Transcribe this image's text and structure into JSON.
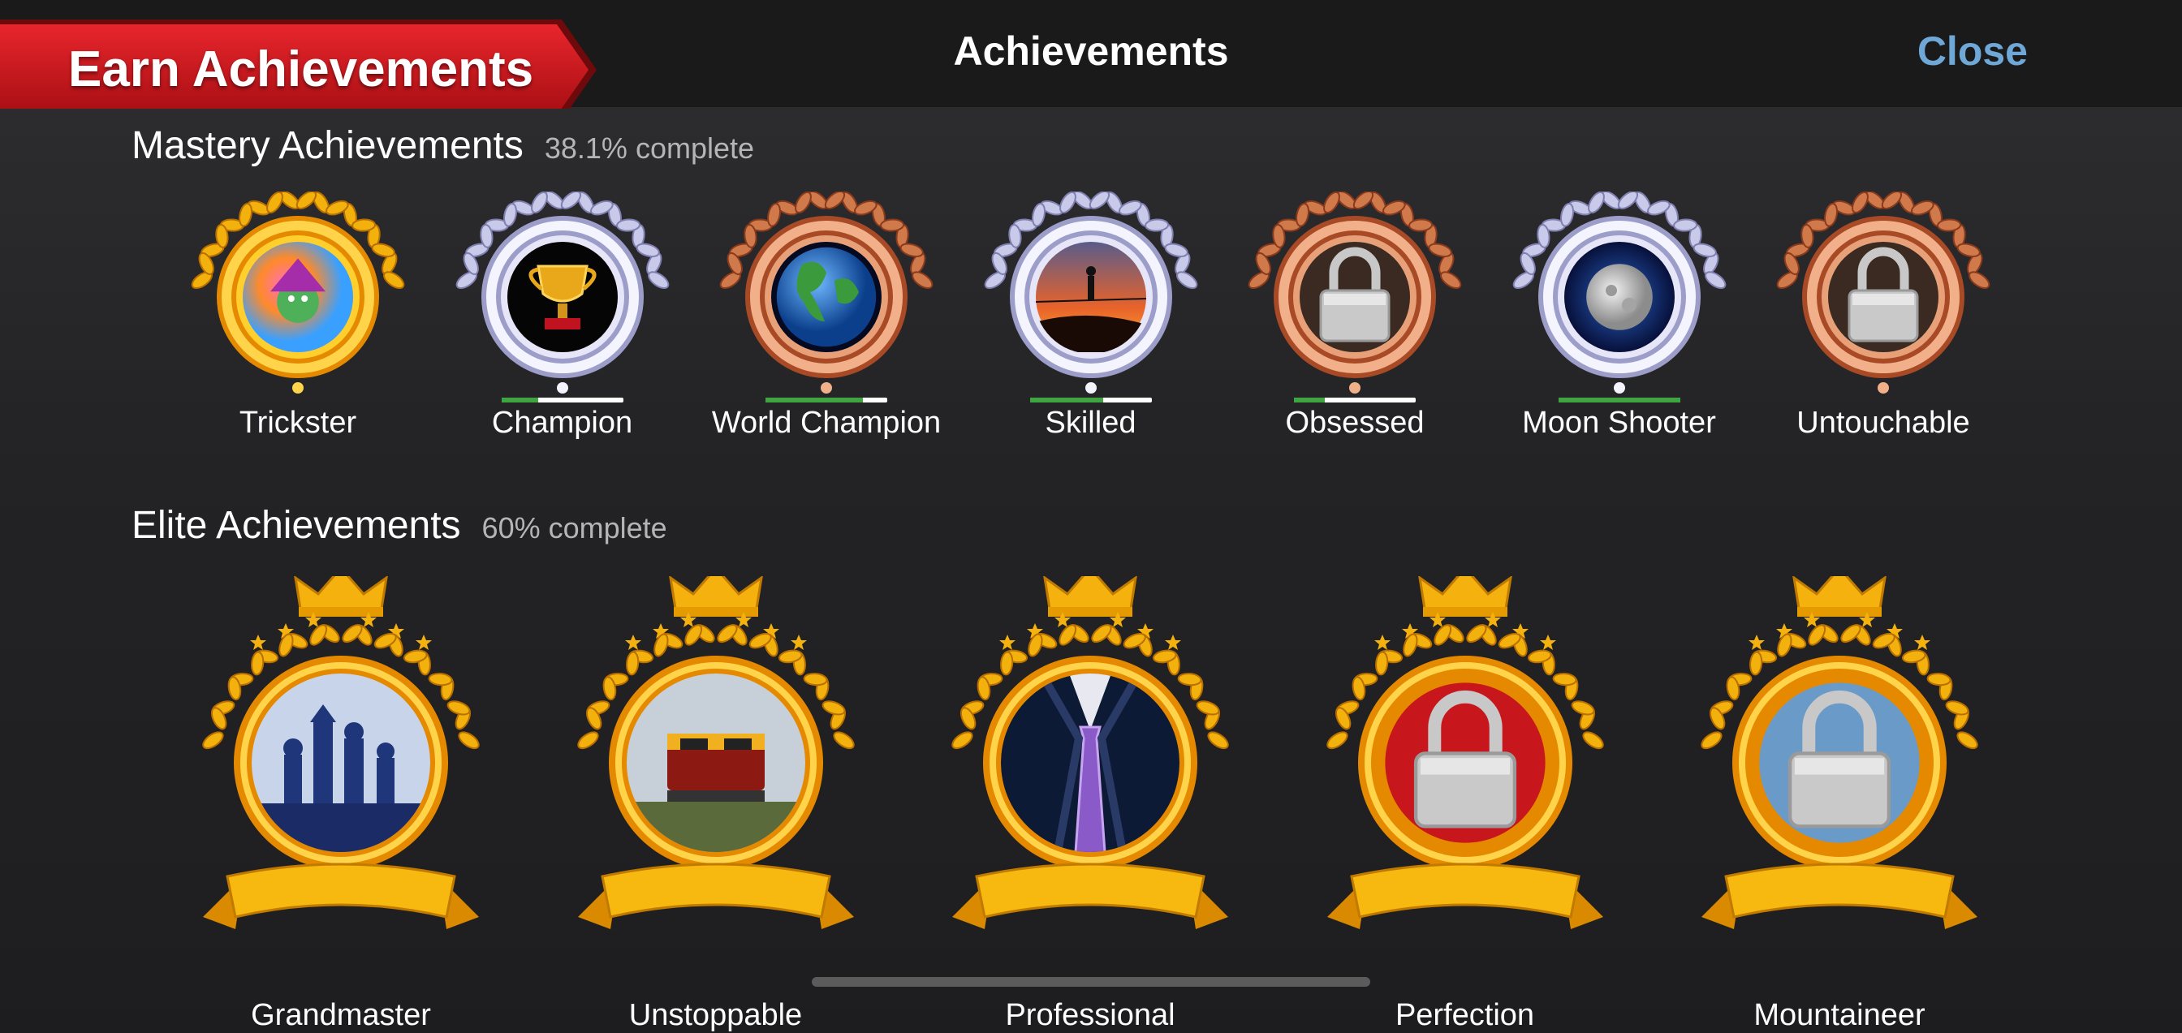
{
  "header": {
    "banner_label": "Earn Achievements",
    "title": "Achievements",
    "close_label": "Close"
  },
  "colors": {
    "accent": "#6fa7d6",
    "banner_red": "#c4161c",
    "progress_green": "#3fa541",
    "gold": "#f5b20e",
    "silver": "#c8c8e8",
    "bronze": "#c06a40"
  },
  "sections": [
    {
      "title": "Mastery Achievements",
      "progress_text": "38.1% complete",
      "items": [
        {
          "label": "Trickster",
          "tier": "gold",
          "icon": "jester-icon",
          "locked": false,
          "progress": null
        },
        {
          "label": "Champion",
          "tier": "silver",
          "icon": "trophy-icon",
          "locked": false,
          "progress": 0.3
        },
        {
          "label": "World Champion",
          "tier": "bronze",
          "icon": "globe-icon",
          "locked": false,
          "progress": 0.8
        },
        {
          "label": "Skilled",
          "tier": "silver",
          "icon": "tightrope-icon",
          "locked": false,
          "progress": 0.6
        },
        {
          "label": "Obsessed",
          "tier": "bronze",
          "icon": "lock-icon",
          "locked": true,
          "progress": 0.25
        },
        {
          "label": "Moon Shooter",
          "tier": "silver",
          "icon": "moon-icon",
          "locked": false,
          "progress": 1.0
        },
        {
          "label": "Untouchable",
          "tier": "bronze",
          "icon": "lock-icon",
          "locked": true,
          "progress": null
        }
      ]
    },
    {
      "title": "Elite Achievements",
      "progress_text": "60% complete",
      "items": [
        {
          "label": "Grandmaster",
          "icon": "chess-icon",
          "locked": false
        },
        {
          "label": "Unstoppable",
          "icon": "train-icon",
          "locked": false
        },
        {
          "label": "Professional",
          "icon": "suit-tie-icon",
          "locked": false
        },
        {
          "label": "Perfection",
          "icon": "lock-icon",
          "locked": true
        },
        {
          "label": "Mountaineer",
          "icon": "lock-icon",
          "locked": true
        }
      ]
    }
  ]
}
